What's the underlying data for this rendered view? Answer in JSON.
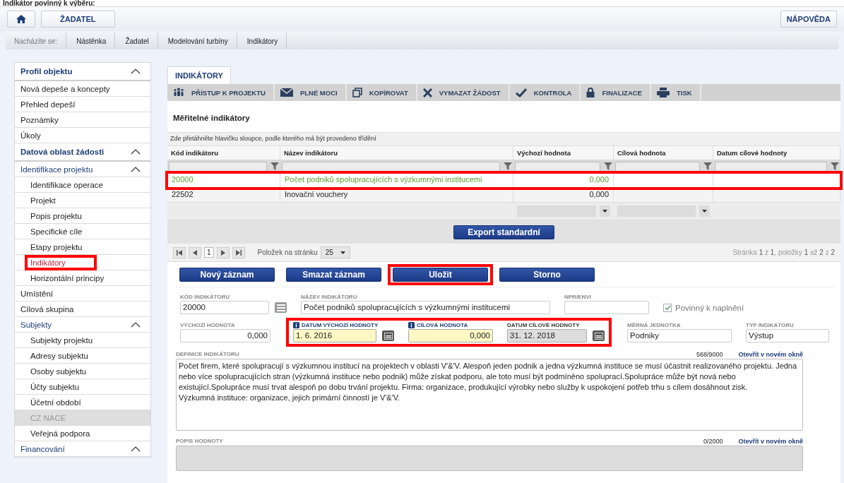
{
  "page_heading": "Indikátor povinný k výběru:",
  "top_bar": {
    "buttons": [
      {
        "kind": "home"
      },
      {
        "kind": "text",
        "label": "ŽADATEL"
      }
    ],
    "help": "NÁPOVĚDA"
  },
  "breadcrumb": {
    "label": "Nacházíte se:",
    "items": [
      "Nástěnka",
      "Žadatel",
      "Modelování turbíny",
      "Indikátory"
    ]
  },
  "sidebar": {
    "items": [
      {
        "kind": "section",
        "label": "Profil objektu",
        "expanded": true,
        "children": [
          {
            "kind": "item",
            "label": "Nová depeše a koncepty",
            "selected": false,
            "disabled": false,
            "highlighted": false
          },
          {
            "kind": "item",
            "label": "Přehled depeší",
            "selected": false,
            "disabled": false,
            "highlighted": false
          },
          {
            "kind": "item",
            "label": "Poznámky",
            "selected": false,
            "disabled": false,
            "highlighted": false
          },
          {
            "kind": "item",
            "label": "Úkoly",
            "selected": false,
            "disabled": false,
            "highlighted": false
          }
        ]
      },
      {
        "kind": "section",
        "label": "Datová oblast žádosti",
        "expanded": true,
        "children": [
          {
            "kind": "group",
            "label": "Identifikace projektu",
            "expanded": true,
            "children": [
              {
                "kind": "item",
                "label": "Identifikace operace",
                "selected": false,
                "disabled": false,
                "highlighted": false
              },
              {
                "kind": "item",
                "label": "Projekt",
                "selected": false,
                "disabled": false,
                "highlighted": false
              },
              {
                "kind": "item",
                "label": "Popis projektu",
                "selected": false,
                "disabled": false,
                "highlighted": false
              },
              {
                "kind": "item",
                "label": "Specifické cíle",
                "selected": false,
                "disabled": false,
                "highlighted": false
              },
              {
                "kind": "item",
                "label": "Etapy projektu",
                "selected": false,
                "disabled": false,
                "highlighted": false
              },
              {
                "kind": "item",
                "label": "Indikátory",
                "selected": true,
                "disabled": false,
                "highlighted": true
              },
              {
                "kind": "item",
                "label": "Horizontální principy",
                "selected": false,
                "disabled": false,
                "highlighted": false
              }
            ]
          },
          {
            "kind": "item",
            "label": "Umístění",
            "selected": false,
            "disabled": false,
            "highlighted": false
          },
          {
            "kind": "item",
            "label": "Cílová skupina",
            "selected": false,
            "disabled": false,
            "highlighted": false
          },
          {
            "kind": "group",
            "label": "Subjekty",
            "expanded": true,
            "children": [
              {
                "kind": "item",
                "label": "Subjekty projektu",
                "selected": false,
                "disabled": false,
                "highlighted": false
              },
              {
                "kind": "item",
                "label": "Adresy subjektu",
                "selected": false,
                "disabled": false,
                "highlighted": false
              },
              {
                "kind": "item",
                "label": "Osoby subjektu",
                "selected": false,
                "disabled": false,
                "highlighted": false
              },
              {
                "kind": "item",
                "label": "Účty subjektu",
                "selected": false,
                "disabled": false,
                "highlighted": false
              },
              {
                "kind": "item",
                "label": "Účetní období",
                "selected": false,
                "disabled": false,
                "highlighted": false
              },
              {
                "kind": "item",
                "label": "CZ NACE",
                "selected": false,
                "disabled": true,
                "highlighted": false
              },
              {
                "kind": "item",
                "label": "Veřejná podpora",
                "selected": false,
                "disabled": false,
                "highlighted": false
              }
            ]
          },
          {
            "kind": "group",
            "label": "Financování",
            "expanded": true
          }
        ]
      }
    ]
  },
  "tab": {
    "label": "INDIKÁTORY",
    "selected": true
  },
  "toolbar": [
    {
      "kind": "people",
      "label": "PŘÍSTUP K PROJEKTU"
    },
    {
      "kind": "mail",
      "label": "PLNÉ MOCI"
    },
    {
      "kind": "copy",
      "label": "KOPÍROVAT"
    },
    {
      "kind": "cross",
      "label": "VYMAZAT ŽÁDOST"
    },
    {
      "kind": "check",
      "label": "KONTROLA"
    },
    {
      "kind": "lock",
      "label": "FINALIZACE"
    },
    {
      "kind": "print",
      "label": "TISK"
    }
  ],
  "section_title": "Měřitelné indikátory",
  "grid": {
    "group_hint": "Zde přetáhněte hlavičku sloupce, podle kterého má být provedeno třídění",
    "columns": [
      {
        "label": "Kód indikátoru",
        "footer_select": false
      },
      {
        "label": "Název indikátoru",
        "footer_select": false
      },
      {
        "label": "Výchozí hodnota",
        "footer_select": true
      },
      {
        "label": "Cílová hodnota",
        "footer_select": true
      },
      {
        "label": "Datum cílové hodnoty",
        "footer_select": false
      }
    ],
    "rows": [
      {
        "selected": true,
        "highlighted": true,
        "cells": [
          "20000",
          "Počet podniků spolupracujících s výzkumnými institucemi",
          "0,000"
        ]
      },
      {
        "selected": false,
        "highlighted": false,
        "cells": [
          "22502",
          "Inovační vouchery",
          "0,000"
        ]
      }
    ],
    "export_button": "Export standardní",
    "pager": {
      "page": "1",
      "page_size_label": "Položek na stránku",
      "page_size": "25",
      "summary": "Stránka **1** z **1**, položky **1** až **2** z **2**"
    }
  },
  "form": {
    "buttons": [
      {
        "label": "Nový záznam",
        "highlighted": false
      },
      {
        "label": "Smazat záznam",
        "highlighted": false
      },
      {
        "label": "Uložit",
        "highlighted": true
      },
      {
        "label": "Storno",
        "highlighted": false
      }
    ],
    "rows": [
      {
        "fields": [
          {
            "kind": "lookup",
            "label": "KÓD INDIKÁTORU",
            "value": "20000",
            "required": false,
            "readonly": false,
            "highlighted": false
          },
          {
            "kind": "text",
            "label": "NÁZEV INDIKÁTORU",
            "value": "Počet podniků spolupracujících s výzkumnými institucemi",
            "required": false,
            "readonly": false,
            "highlighted": false
          },
          {
            "kind": "text",
            "label": "NPR/ENVI",
            "required": false,
            "readonly": false,
            "highlighted": false
          },
          {
            "kind": "checkbox",
            "label": "Povinný k naplnění",
            "checked": true,
            "highlighted": false
          }
        ]
      },
      {
        "fields": [
          {
            "kind": "number",
            "label": "VÝCHOZÍ HODNOTA",
            "value": "0,000",
            "required": false,
            "readonly": false,
            "highlighted": false
          },
          {
            "kind": "date",
            "label": "DATUM VÝCHOZÍ HODNOTY",
            "value": "1. 6. 2016",
            "required": true,
            "readonly": false,
            "highlighted": true
          },
          {
            "kind": "number",
            "label": "CÍLOVÁ HODNOTA",
            "value": "0,000",
            "required": true,
            "readonly": false,
            "highlighted": true
          },
          {
            "kind": "date",
            "label": "DATUM CÍLOVÉ HODNOTY",
            "value": "31. 12. 2018",
            "required": false,
            "readonly": true,
            "highlighted": true
          },
          {
            "kind": "text",
            "label": "MĚRNÁ JEDNOTKA",
            "value": "Podniky",
            "required": false,
            "readonly": false,
            "highlighted": false
          },
          {
            "kind": "text",
            "label": "TYP INDIKÁTORU",
            "value": "Výstup",
            "required": false,
            "readonly": false,
            "highlighted": false
          }
        ]
      }
    ],
    "textareas": [
      {
        "label": "DEFINICE INDIKÁTORU",
        "counter": "568/9000",
        "link": "Otevřít v novém okně",
        "readonly": false,
        "value": "Počet firem, které spolupracují s výzkumnou institucí na projektech v oblasti V'&'V. Alespoň jeden podnik a jedna výzkumná instituce se musí účastnit realizovaného projektu. Jedna nebo více spolupracujících stran (výzkumná instituce nebo podnik) může získat podporu, ale toto musí být podmíněno spoluprací.Spolupráce může být nová nebo existující.Spolupráce musí trvat alespoň po dobu trvání projektu. Firma: organizace, produkující výrobky nebo služby k uspokojení potřeb trhu s cílem dosáhnout zisk.\nVýzkumná instituce: organizace, jejich primární činností je V'&'V."
      },
      {
        "label": "POPIS HODNOTY",
        "counter": "0/2000",
        "link": "Otevřít v novém okně",
        "readonly": true
      }
    ]
  }
}
